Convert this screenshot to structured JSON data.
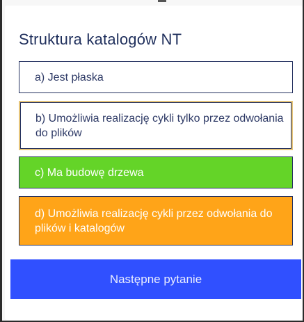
{
  "quiz": {
    "question": "Struktura katalogów NT",
    "options": [
      {
        "label": "a) Jest płaska"
      },
      {
        "label": "b) Umożliwia realizację cykli tylko przez odwołania do plików"
      },
      {
        "label": "c) Ma budowę drzewa"
      },
      {
        "label": "d) Umożliwia realizację cykli przez odwołania do plików i katalogów"
      }
    ],
    "next_label": "Następne pytanie"
  },
  "colors": {
    "title": "#1f2f5c",
    "border": "#23305f",
    "selected_outline": "#e6c57a",
    "correct": "#64d428",
    "partial": "#ffa418",
    "next_button": "#3050ff"
  }
}
